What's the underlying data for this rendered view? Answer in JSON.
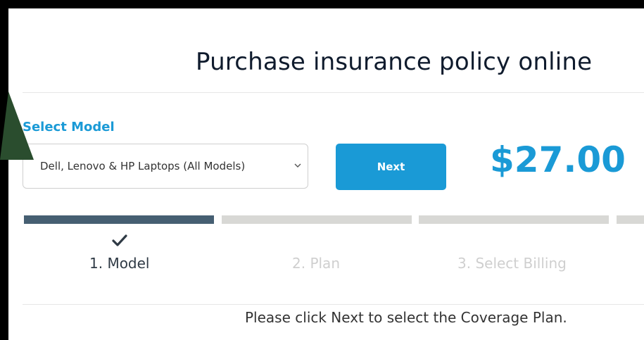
{
  "header": {
    "title": "Purchase insurance policy online"
  },
  "model_select": {
    "label": "Select Model",
    "selected_value": "Dell, Lenovo & HP Laptops (All Models)"
  },
  "actions": {
    "next_label": "Next"
  },
  "price": {
    "amount": "$27.00"
  },
  "steps": [
    {
      "label": "1. Model",
      "state": "completed"
    },
    {
      "label": "2. Plan",
      "state": "pending"
    },
    {
      "label": "3. Select Billing",
      "state": "pending"
    }
  ],
  "progress": {
    "completed_steps": 1,
    "total_segments": 4
  },
  "footer": {
    "note": "Please click Next to select the Coverage Plan."
  },
  "colors": {
    "accent": "#1a9ad6",
    "progress_active": "#465f72",
    "progress_inactive": "#d8d8d5",
    "annotation_arrow": "#2a4d2e"
  },
  "icons": {
    "check": "check-icon",
    "chevron": "chevron-down-icon",
    "annotation": "arrow-annotation"
  }
}
